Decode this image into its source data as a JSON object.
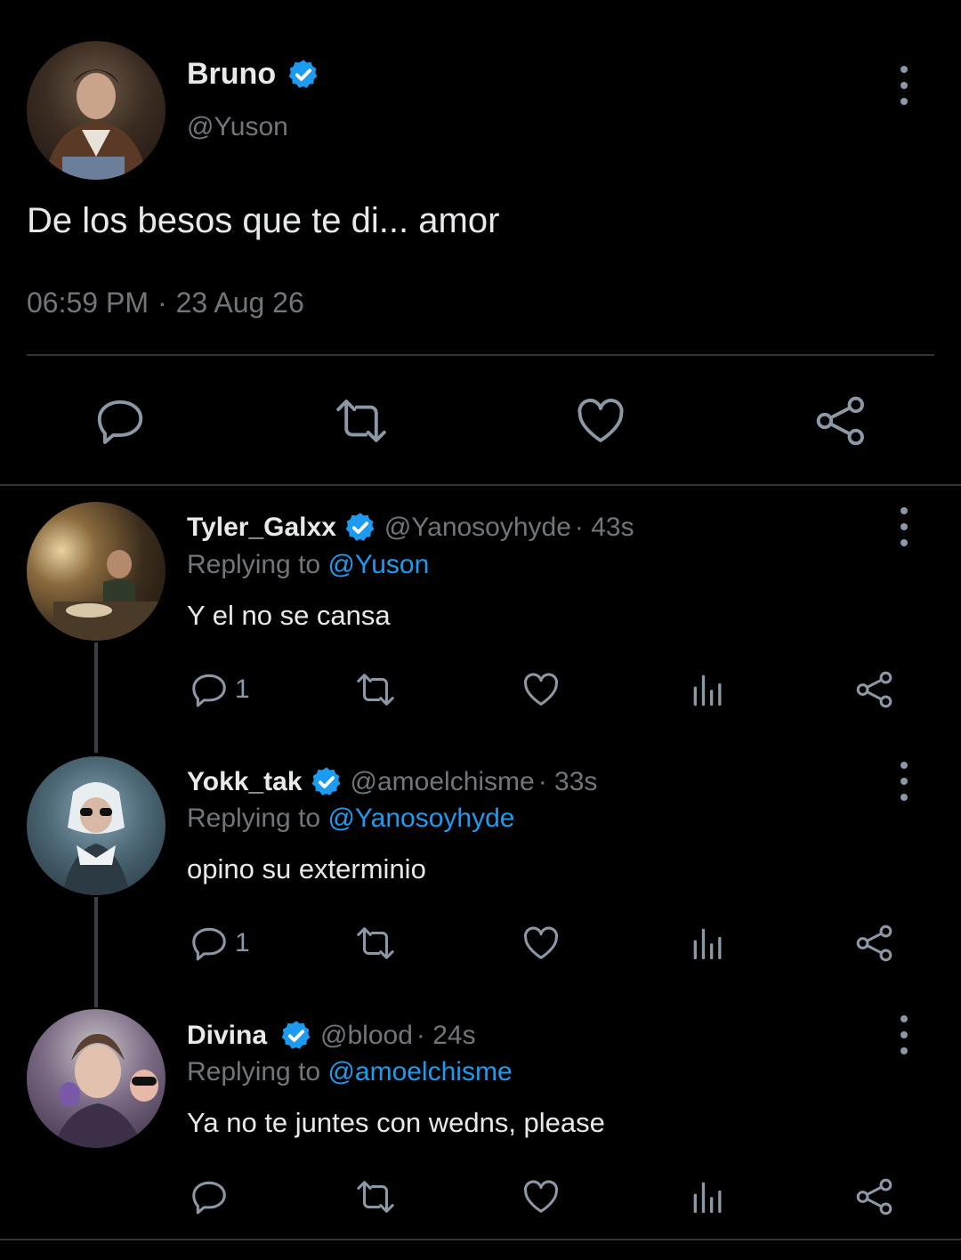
{
  "colors": {
    "background": "#000000",
    "text": "#e7e9ea",
    "muted": "#71767b",
    "accent": "#1d9bf0",
    "icon": "#8b98a5"
  },
  "main_tweet": {
    "author_name": "Bruno",
    "handle": "@Yuson",
    "text": "De los besos que te di... amor",
    "time": "06:59 PM",
    "separator": "·",
    "date": "23 Aug 26",
    "actions": [
      "reply-icon",
      "retweet-icon",
      "heart-icon",
      "share-icon"
    ]
  },
  "replies": [
    {
      "name": "Tyler_Galxx",
      "handle": "@Yanosoyhyde",
      "time": "· 43s",
      "replying_prefix": "Replying to",
      "replying_to": "@Yuson",
      "text": "Y el no se cansa",
      "reply_count": "1"
    },
    {
      "name": "Yokk_tak",
      "handle": "@amoelchisme",
      "time": "· 33s",
      "replying_prefix": "Replying to",
      "replying_to": "@Yanosoyhyde",
      "text": "opino su exterminio",
      "reply_count": "1"
    },
    {
      "name": "Divina",
      "handle": "@blood",
      "time": "· 24s",
      "replying_prefix": "Replying to",
      "replying_to": "@amoelchisme",
      "text": "Ya no te juntes con wedns, please",
      "reply_count": ""
    }
  ]
}
